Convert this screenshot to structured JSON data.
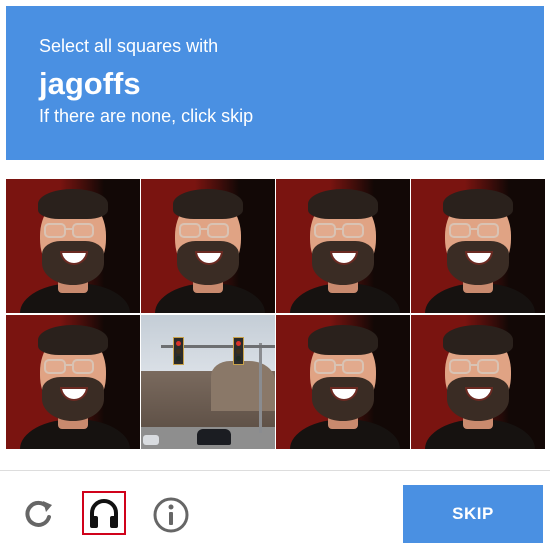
{
  "header": {
    "instruction": "Select all squares with",
    "target_word": "jagoffs",
    "hint": "If there are none, click skip",
    "background_color": "#4a90e2"
  },
  "grid": {
    "rows": 2,
    "columns": 4,
    "tiles": [
      {
        "row": 1,
        "col": 1,
        "content": "man-with-glasses-photo"
      },
      {
        "row": 1,
        "col": 2,
        "content": "man-with-glasses-photo"
      },
      {
        "row": 1,
        "col": 3,
        "content": "man-with-glasses-photo"
      },
      {
        "row": 1,
        "col": 4,
        "content": "man-with-glasses-photo"
      },
      {
        "row": 2,
        "col": 1,
        "content": "man-with-glasses-photo"
      },
      {
        "row": 2,
        "col": 2,
        "content": "traffic-lights-street-photo"
      },
      {
        "row": 2,
        "col": 3,
        "content": "man-with-glasses-photo"
      },
      {
        "row": 2,
        "col": 4,
        "content": "man-with-glasses-photo"
      }
    ]
  },
  "footer": {
    "icons": [
      "reload-icon",
      "headphones-icon",
      "info-icon"
    ],
    "skip_label": "SKIP",
    "skip_color": "#4a90e2",
    "audio_highlight_color": "#d0021b"
  }
}
